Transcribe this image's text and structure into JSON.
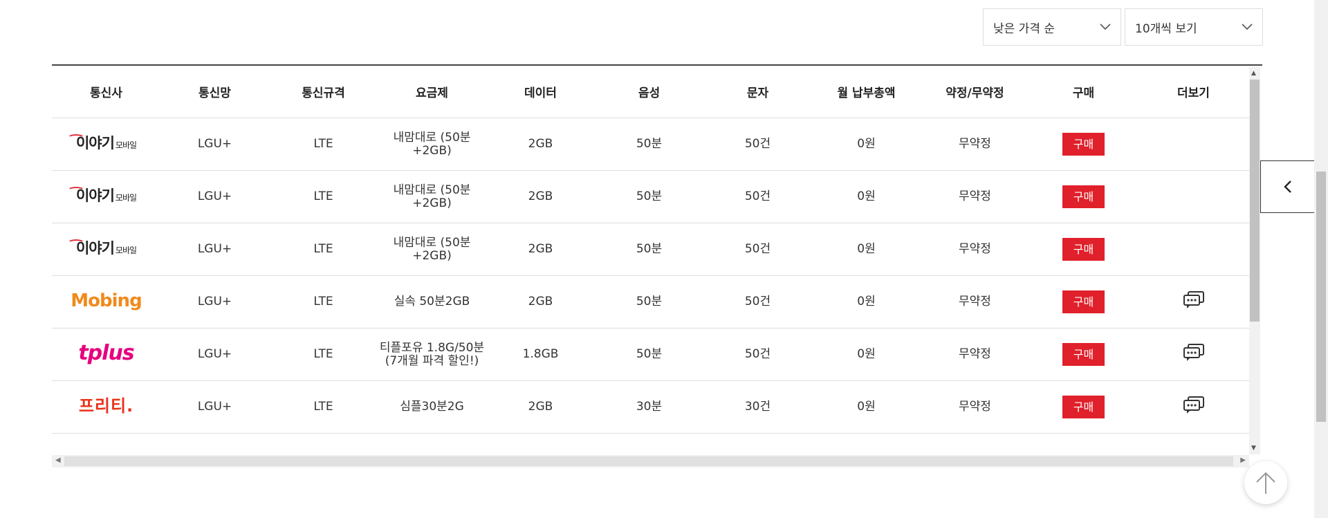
{
  "controls": {
    "sort": "낮은 가격 순",
    "per_page": "10개씩 보기"
  },
  "table": {
    "headers": [
      "통신사",
      "통신망",
      "통신규격",
      "요금제",
      "데이터",
      "음성",
      "문자",
      "월 납부총액",
      "약정/무약정",
      "구매",
      "더보기"
    ],
    "buy_label": "구매",
    "rows": [
      {
        "carrier": "이야기",
        "carrier_sub": "모바일",
        "network": "LGU+",
        "spec": "LTE",
        "plan": "내맘대로 (50분+2GB)",
        "data": "2GB",
        "voice": "50분",
        "sms": "50건",
        "monthly": "0원",
        "contract": "무약정"
      },
      {
        "carrier": "이야기",
        "carrier_sub": "모바일",
        "network": "LGU+",
        "spec": "LTE",
        "plan": "내맘대로 (50분+2GB)",
        "data": "2GB",
        "voice": "50분",
        "sms": "50건",
        "monthly": "0원",
        "contract": "무약정"
      },
      {
        "carrier": "이야기",
        "carrier_sub": "모바일",
        "network": "LGU+",
        "spec": "LTE",
        "plan": "내맘대로 (50분+2GB)",
        "data": "2GB",
        "voice": "50분",
        "sms": "50건",
        "monthly": "0원",
        "contract": "무약정"
      },
      {
        "carrier": "Mobing",
        "network": "LGU+",
        "spec": "LTE",
        "plan": "실속 50분2GB",
        "data": "2GB",
        "voice": "50분",
        "sms": "50건",
        "monthly": "0원",
        "contract": "무약정"
      },
      {
        "carrier": "tplus",
        "network": "LGU+",
        "spec": "LTE",
        "plan": "티플포유 1.8G/50분",
        "plan_sub": "(7개월 파격 할인!)",
        "data": "1.8GB",
        "voice": "50분",
        "sms": "50건",
        "monthly": "0원",
        "contract": "무약정"
      },
      {
        "carrier": "프리티.",
        "network": "LGU+",
        "spec": "LTE",
        "plan": "심플30분2G",
        "data": "2GB",
        "voice": "30분",
        "sms": "30건",
        "monthly": "0원",
        "contract": "무약정"
      }
    ]
  },
  "icons": {
    "chevron_down": "chevron-down-icon",
    "chevron_left": "chevron-left-icon",
    "arrow_up": "arrow-up-icon",
    "more": "chat-bubbles-icon"
  },
  "colors": {
    "buy_button": "#e0202a",
    "iyagi_accent": "#e32636",
    "mobing": "#f08a1c",
    "tplus": "#e6007e",
    "freet": "#e8321a"
  }
}
